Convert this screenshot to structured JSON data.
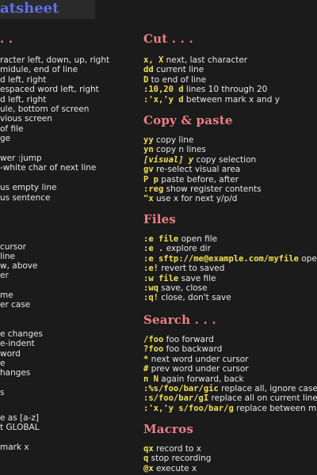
{
  "title": "atsheet",
  "left_column": {
    "heading_top": ". .",
    "lines": [
      "racter left, down, up, right",
      "midule, end of line",
      "d left, right",
      "espaced word left, right",
      "d left, right",
      "ule, bottom of screen",
      "vious screen",
      "of file",
      "ge",
      "",
      "wer :jump",
      "-white char of next line",
      "",
      "us empty line",
      "us sentence",
      "",
      "",
      "",
      "cursor",
      "line",
      "w, above",
      "er",
      "",
      "me",
      "er case",
      "",
      "",
      "e changes",
      "e-indent",
      "word",
      "e",
      "hanges",
      "",
      "s",
      "",
      "e as [a-z]",
      "t GLOBAL",
      "",
      "mark x"
    ]
  },
  "sections": [
    {
      "heading": "Cut . . .",
      "items": [
        {
          "keys": "x, X",
          "italic": false,
          "desc": " next, last character"
        },
        {
          "keys": "dd",
          "italic": false,
          "desc": " current line"
        },
        {
          "keys": "D",
          "italic": false,
          "desc": " to end of line"
        },
        {
          "keys": ":10,20 d",
          "italic": false,
          "desc": " lines 10 through 20"
        },
        {
          "keys": ":'x,'y d",
          "italic": false,
          "desc": " between mark x and y"
        }
      ]
    },
    {
      "heading": "Copy & paste",
      "items": [
        {
          "keys": "yy",
          "italic": false,
          "desc": " copy line"
        },
        {
          "keys": "yn",
          "italic": false,
          "desc": " copy n lines"
        },
        {
          "keys": "[visual] y",
          "italic": true,
          "desc": " copy selection"
        },
        {
          "keys": "gv",
          "italic": false,
          "desc": " re-select visual area"
        },
        {
          "keys": "P p",
          "italic": false,
          "desc": " paste before, after"
        },
        {
          "keys": ":reg",
          "italic": false,
          "desc": " show register contents"
        },
        {
          "keys": "\"x",
          "italic": false,
          "desc": " use x for next y/p/d"
        }
      ]
    },
    {
      "heading": "Files",
      "items": [
        {
          "keys": ":e file",
          "italic": false,
          "desc": " open file"
        },
        {
          "keys": ":e .",
          "italic": false,
          "desc": " explore dir"
        },
        {
          "keys": ":e sftp://me@example.com/myfile",
          "italic": false,
          "desc": " open"
        },
        {
          "keys": ":e!",
          "italic": false,
          "desc": " revert to saved"
        },
        {
          "keys": ":w file",
          "italic": false,
          "desc": " save file"
        },
        {
          "keys": ":wq",
          "italic": false,
          "desc": " save, close"
        },
        {
          "keys": ":q!",
          "italic": false,
          "desc": " close, don't save"
        }
      ]
    },
    {
      "heading": "Search . . .",
      "items": [
        {
          "keys": "/foo",
          "italic": false,
          "desc": " foo forward"
        },
        {
          "keys": "?foo",
          "italic": false,
          "desc": " foo backward"
        },
        {
          "keys": "*",
          "italic": false,
          "desc": " next word under cursor"
        },
        {
          "keys": "#",
          "italic": false,
          "desc": " prev word under cursor"
        },
        {
          "keys": "n N",
          "italic": false,
          "desc": " again forward, back"
        },
        {
          "keys": ":%s/foo/bar/gic",
          "italic": false,
          "desc": " replace all, ignore case,"
        },
        {
          "keys": ":s/foo/bar/gI",
          "italic": false,
          "desc": " replace all on current line, n"
        },
        {
          "keys": ":'x,'y s/foo/bar/g",
          "italic": false,
          "desc": " replace between mar"
        }
      ]
    },
    {
      "heading": "Macros",
      "items": [
        {
          "keys": "qx",
          "italic": false,
          "desc": " record to x"
        },
        {
          "keys": "q",
          "italic": false,
          "desc": " stop recording"
        },
        {
          "keys": "@x",
          "italic": false,
          "desc": " execute x"
        }
      ]
    }
  ]
}
